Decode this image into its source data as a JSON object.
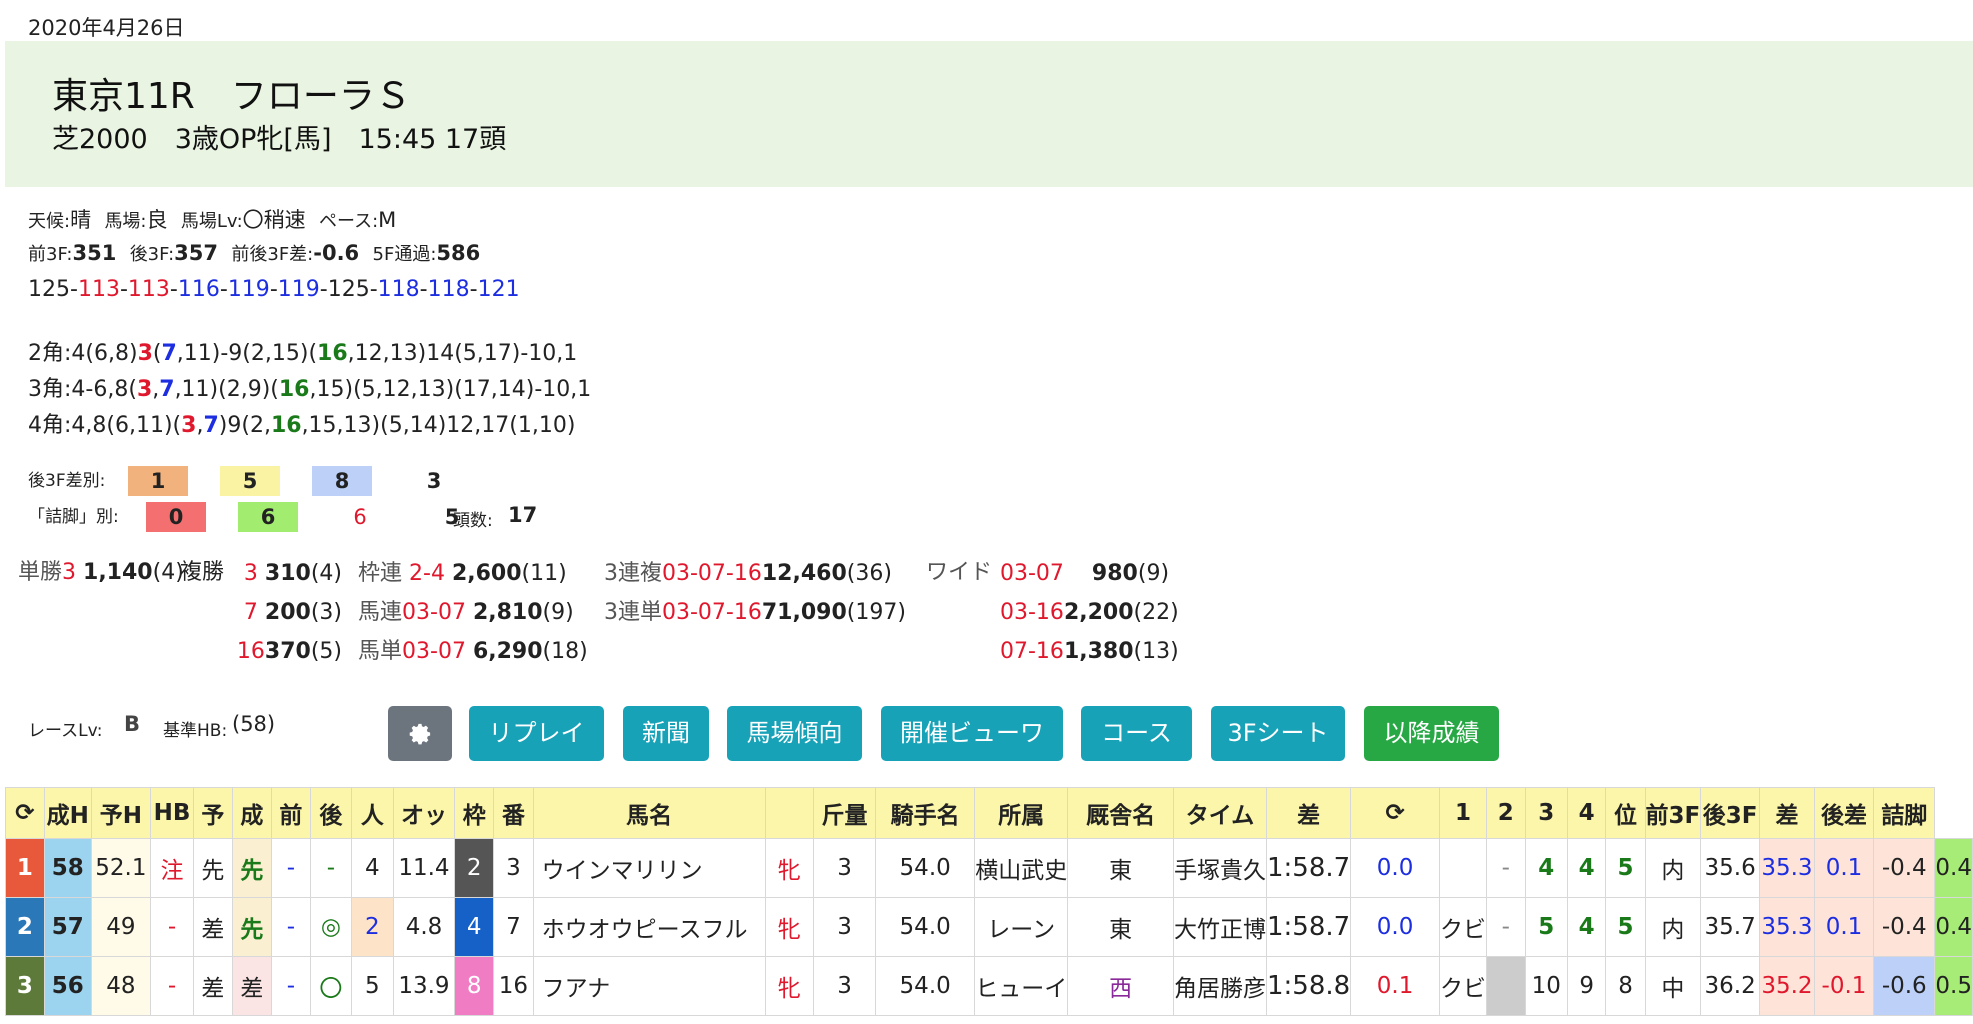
{
  "date": "2020年4月26日",
  "race": {
    "title": "東京11R　フローラＳ",
    "subtitle": "芝2000　3歳OP牝[馬]　15:45 17頭"
  },
  "conditions": {
    "weather_label": "天候:",
    "weather": "晴",
    "track_label": "馬場:",
    "track": "良",
    "track_lv_label": "馬場Lv:",
    "track_lv": "〇稍速",
    "pace_label": "ペース:",
    "pace": "M"
  },
  "splits": {
    "first3f_label": "前3F:",
    "first3f": "351",
    "last3f_label": "後3F:",
    "last3f": "357",
    "diff_label": "前後3F差:",
    "diff": "-0.6",
    "pass5f_label": "5F通過:",
    "pass5f": "586"
  },
  "laps": [
    {
      "v": "125",
      "c": "#222222"
    },
    {
      "v": "113",
      "c": "#e0182d"
    },
    {
      "v": "113",
      "c": "#e0182d"
    },
    {
      "v": "116",
      "c": "#1c2ee0"
    },
    {
      "v": "119",
      "c": "#1c2ee0"
    },
    {
      "v": "119",
      "c": "#1c2ee0"
    },
    {
      "v": "125",
      "c": "#222222"
    },
    {
      "v": "118",
      "c": "#1c2ee0"
    },
    {
      "v": "118",
      "c": "#1c2ee0"
    },
    {
      "v": "121",
      "c": "#1c2ee0"
    }
  ],
  "corners": [
    {
      "label": "2角:",
      "parts": [
        {
          "t": "4(6,8)"
        },
        {
          "t": "3",
          "c": "red"
        },
        {
          "t": "("
        },
        {
          "t": "7",
          "c": "blue"
        },
        {
          "t": ",11)-9(2,15)("
        },
        {
          "t": "16",
          "c": "green"
        },
        {
          "t": ",12,13)14(5,17)-10,1"
        }
      ]
    },
    {
      "label": "3角:",
      "parts": [
        {
          "t": "4-6,8("
        },
        {
          "t": "3",
          "c": "red"
        },
        {
          "t": ","
        },
        {
          "t": "7",
          "c": "blue"
        },
        {
          "t": ",11)(2,9)("
        },
        {
          "t": "16",
          "c": "green"
        },
        {
          "t": ",15)(5,12,13)(17,14)-10,1"
        }
      ]
    },
    {
      "label": "4角:",
      "parts": [
        {
          "t": "4,8(6,11)("
        },
        {
          "t": "3",
          "c": "red"
        },
        {
          "t": ","
        },
        {
          "t": "7",
          "c": "blue"
        },
        {
          "t": ")9(2,"
        },
        {
          "t": "16",
          "c": "green"
        },
        {
          "t": ",15,13)(5,14)12,17(1,10)"
        }
      ]
    }
  ],
  "last3f_rank": {
    "label": "後3F差別:",
    "chips": [
      {
        "v": "1",
        "bg": "#f2b27e"
      },
      {
        "v": "5",
        "bg": "#f9f3a3"
      },
      {
        "v": "8",
        "bg": "#bcd0f8"
      },
      {
        "v": "3",
        "bg": "transparent"
      }
    ]
  },
  "tsume_rank": {
    "label": "「詰脚」別:",
    "chips": [
      {
        "v": "0",
        "bg": "#f47070"
      },
      {
        "v": "6",
        "bg": "#a2ec6f"
      },
      {
        "v": "6",
        "bg": "transparent",
        "c": "#e0182d"
      },
      {
        "v": "5",
        "bg": "transparent"
      }
    ],
    "heads_label": "頭数:",
    "heads": "17"
  },
  "payouts": {
    "tansho": {
      "label": "単勝",
      "num": "3",
      "amt": "1,140",
      "pop": "(4)"
    },
    "fukusho": {
      "label": "複勝",
      "rows": [
        {
          "num": "3",
          "amt": "310",
          "pop": "(4)"
        },
        {
          "num": "7",
          "amt": "200",
          "pop": "(3)"
        },
        {
          "num": "16",
          "amt": "370",
          "pop": "(5)"
        }
      ]
    },
    "wakuren": {
      "label": "枠連",
      "num": "2-4",
      "amt": "2,600",
      "pop": "(11)"
    },
    "umaren": {
      "label": "馬連",
      "num": "03-07",
      "amt": "2,810",
      "pop": "(9)"
    },
    "umatan": {
      "label": "馬単",
      "num": "03-07",
      "amt": "6,290",
      "pop": "(18)"
    },
    "sanfuku": {
      "label": "3連複",
      "num": "03-07-16",
      "amt": "12,460",
      "pop": "(36)"
    },
    "santan": {
      "label": "3連単",
      "num": "03-07-16",
      "amt": "71,090",
      "pop": "(197)"
    },
    "wide": {
      "label": "ワイド",
      "rows": [
        {
          "num": "03-07",
          "amt": "980",
          "pop": "(9)"
        },
        {
          "num": "03-16",
          "amt": "2,200",
          "pop": "(22)"
        },
        {
          "num": "07-16",
          "amt": "1,380",
          "pop": "(13)"
        }
      ]
    }
  },
  "race_level": {
    "label": "レースLv:",
    "value": "B",
    "hb_label": "基準HB:",
    "hb": "(58)"
  },
  "buttons": {
    "gear": "gear-icon",
    "replay": "リプレイ",
    "paper": "新聞",
    "trend": "馬場傾向",
    "viewer": "開催ビューワ",
    "course": "コース",
    "sheet": "3Fシート",
    "later": "以降成績"
  },
  "table": {
    "headers": [
      "⟳",
      "成H",
      "予H",
      "HB",
      "予",
      "成",
      "前",
      "後",
      "人",
      "オッ",
      "枠",
      "番",
      "馬名",
      "",
      "斤量",
      "騎手名",
      "所属",
      "厩舎名",
      "タイム",
      "差",
      "⟳",
      "1",
      "2",
      "3",
      "4",
      "位",
      "前3F",
      "後3F",
      "差",
      "後差",
      "詰脚"
    ],
    "rows": [
      {
        "rank": "1",
        "rank_bg": "#e8583a",
        "seiH": "58",
        "yoH": "52.1",
        "hb": "注",
        "yo": "先",
        "sei": "先",
        "mae": "-",
        "ato": "-",
        "pop": "4",
        "odds": "11.4",
        "waku": "2",
        "waku_bg": "#555555",
        "waku_fg": "#ffffff",
        "ban": "3",
        "name": "ウインマリリン",
        "sex": "牝",
        "age": "3",
        "kin": "54.0",
        "jockey": "横山武史",
        "aff": "東",
        "aff_c": "#222222",
        "trainer": "手塚貴久",
        "time": "1:58.7",
        "sa": "0.0",
        "sa_c": "#1c2ee0",
        "memo": "",
        "c1": "-",
        "c2": "4",
        "c3": "4",
        "c4": "5",
        "pos": "内",
        "f3": "35.6",
        "l3": "35.3",
        "l3_c": "#1c2ee0",
        "l3_bg": "#fde3d8",
        "d": "0.1",
        "d_c": "#1c2ee0",
        "ld": "-0.4",
        "tsume": "0.4",
        "tsume_bg": "#a8ec78"
      },
      {
        "rank": "2",
        "rank_bg": "#2a78b8",
        "seiH": "57",
        "yoH": "49",
        "hb": "-",
        "yo": "差",
        "sei": "先",
        "mae": "-",
        "ato": "◎",
        "pop": "2",
        "odds": "4.8",
        "waku": "4",
        "waku_bg": "#1561c7",
        "waku_fg": "#ffffff",
        "ban": "7",
        "name": "ホウオウピースフル",
        "sex": "牝",
        "age": "3",
        "kin": "54.0",
        "jockey": "レーン",
        "aff": "東",
        "aff_c": "#222222",
        "trainer": "大竹正博",
        "time": "1:58.7",
        "sa": "0.0",
        "sa_c": "#1c2ee0",
        "memo": "クビ",
        "c1": "-",
        "c2": "5",
        "c3": "4",
        "c4": "5",
        "pos": "内",
        "f3": "35.7",
        "l3": "35.3",
        "l3_c": "#1c2ee0",
        "l3_bg": "#fde3d8",
        "d": "0.1",
        "d_c": "#1c2ee0",
        "ld": "-0.4",
        "tsume": "0.4",
        "tsume_bg": "#a8ec78"
      },
      {
        "rank": "3",
        "rank_bg": "#5e7a3a",
        "seiH": "56",
        "yoH": "48",
        "hb": "-",
        "yo": "差",
        "sei": "差",
        "mae": "-",
        "ato": "〇",
        "pop": "5",
        "odds": "13.9",
        "waku": "8",
        "waku_bg": "#f07cc4",
        "waku_fg": "#ffffff",
        "ban": "16",
        "name": "フアナ",
        "sex": "牝",
        "age": "3",
        "kin": "54.0",
        "jockey": "ヒューイ",
        "aff": "西",
        "aff_c": "#8a2a9a",
        "trainer": "角居勝彦",
        "time": "1:58.8",
        "sa": "0.1",
        "sa_c": "#e0182d",
        "memo": "クビ",
        "c1": "",
        "c2": "10",
        "c3": "9",
        "c4": "8",
        "pos": "中",
        "f3": "36.2",
        "l3": "35.2",
        "l3_c": "#e0182d",
        "l3_bg": "#fde3d8",
        "d": "-0.1",
        "d_c": "#e0182d",
        "ld": "-0.6",
        "tsume": "0.5",
        "tsume_bg": "#a8ec78"
      }
    ]
  }
}
